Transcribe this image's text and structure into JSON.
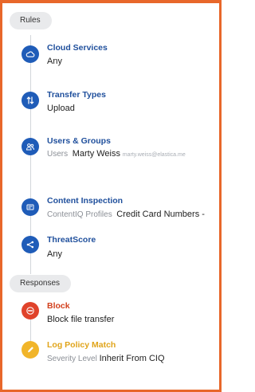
{
  "sections": {
    "rules_label": "Rules",
    "responses_label": "Responses"
  },
  "rules": {
    "cloud_services": {
      "title": "Cloud Services",
      "value": "Any"
    },
    "transfer_types": {
      "title": "Transfer Types",
      "value": "Upload"
    },
    "users_groups": {
      "title": "Users & Groups",
      "prefix": "Users",
      "user": "Marty Weiss",
      "email": "marty.weiss@elastica.me"
    },
    "content_inspection": {
      "title": "Content Inspection",
      "prefix": "ContentIQ Profiles",
      "value": "Credit Card Numbers -"
    },
    "threat_score": {
      "title": "ThreatScore",
      "value": "Any"
    }
  },
  "responses": {
    "block": {
      "title": "Block",
      "value": "Block file transfer"
    },
    "log_policy": {
      "title": "Log Policy Match",
      "prefix": "Severity Level",
      "value": "Inherit From CIQ"
    }
  },
  "colors": {
    "accent_blue": "#1f5cb8",
    "block_red": "#e0432b",
    "log_yellow": "#f1b52a",
    "frame_orange": "#e8672a"
  },
  "icons": {
    "cloud_services": "cloud-icon",
    "transfer_types": "transfer-arrows-icon",
    "users_groups": "users-icon",
    "content_inspection": "document-icon",
    "threat_score": "share-icon",
    "block": "no-entry-icon",
    "log_policy": "pencil-icon"
  }
}
